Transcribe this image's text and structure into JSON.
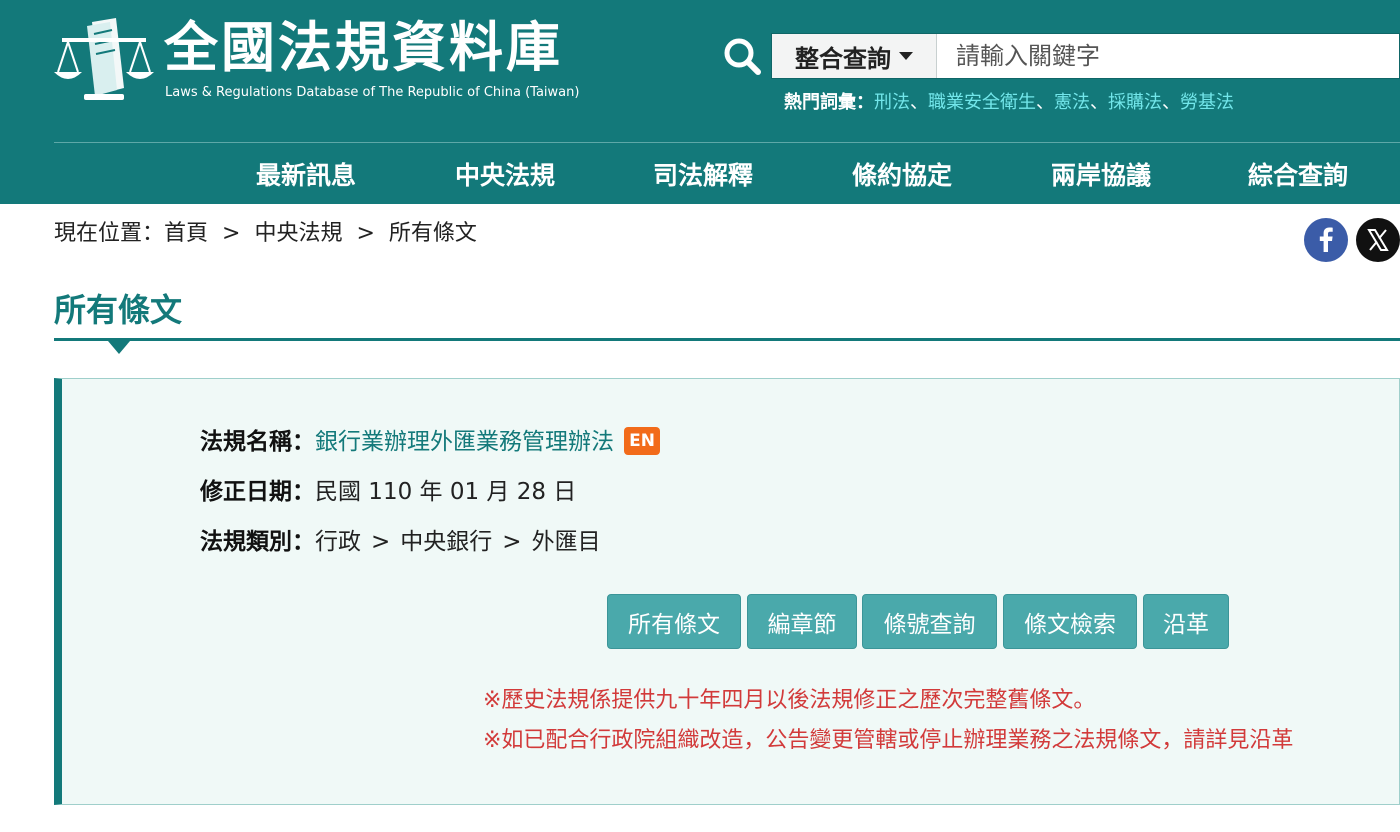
{
  "header": {
    "title": "全國法規資料庫",
    "subtitle": "Laws & Regulations Database of The Republic of China (Taiwan)",
    "search": {
      "scope_label": "整合查詢",
      "placeholder": "請輸入關鍵字",
      "value": ""
    },
    "hot_terms": {
      "label": "熱門詞彙：",
      "items": [
        "刑法",
        "職業安全衛生",
        "憲法",
        "採購法",
        "勞基法"
      ],
      "separator": "、"
    },
    "nav": [
      "最新訊息",
      "中央法規",
      "司法解釋",
      "條約協定",
      "兩岸協議",
      "綜合查詢"
    ]
  },
  "breadcrumb": {
    "prefix": "現在位置：",
    "items": [
      "首頁",
      "中央法規",
      "所有條文"
    ],
    "separator": ">"
  },
  "page_title": "所有條文",
  "info": {
    "name_label": "法規名稱：",
    "name_value": "銀行業辦理外匯業務管理辦法",
    "en_badge": "EN",
    "date_label": "修正日期：",
    "date_value": "民國 110 年 01 月 28 日",
    "category_label": "法規類別：",
    "category_items": [
      "行政",
      "中央銀行",
      "外匯目"
    ],
    "category_separator": ">"
  },
  "buttons": [
    "所有條文",
    "編章節",
    "條號查詢",
    "條文檢索",
    "沿革"
  ],
  "notes": [
    "※歷史法規係提供九十年四月以後法規修正之歷次完整舊條文。",
    "※如已配合行政院組織改造，公告變更管轄或停止辦理業務之法規條文，請詳見沿革"
  ],
  "colors": {
    "brand": "#13797a",
    "hot_term_link": "#72e6ea",
    "button": "#4aa9ab",
    "note": "#d23a3a",
    "en_badge": "#f26b1a",
    "facebook": "#3b5ca8",
    "x": "#111111"
  },
  "icons": {
    "logo": "scales-of-justice-book-icon",
    "search": "search-icon",
    "facebook": "facebook-icon",
    "x": "x-icon"
  }
}
